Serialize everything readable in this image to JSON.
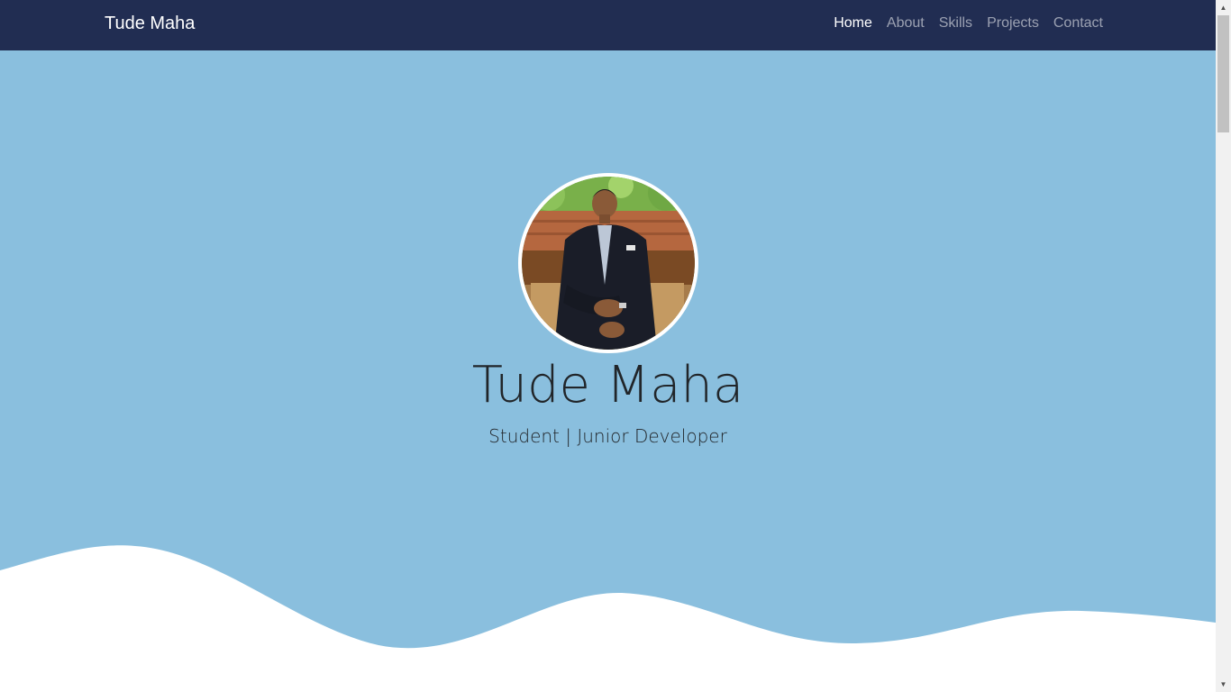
{
  "navbar": {
    "brand": "Tude Maha",
    "links": [
      {
        "label": "Home",
        "active": true
      },
      {
        "label": "About",
        "active": false
      },
      {
        "label": "Skills",
        "active": false
      },
      {
        "label": "Projects",
        "active": false
      },
      {
        "label": "Contact",
        "active": false
      }
    ]
  },
  "hero": {
    "name": "Tude Maha",
    "tagline": "Student | Junior Developer"
  },
  "colors": {
    "navbar_bg": "#212d52",
    "hero_bg": "#8abfde",
    "wave": "#ffffff",
    "text_dark": "#212529"
  },
  "icons": {
    "avatar": "profile-photo",
    "scroll_up": "chevron-up-icon",
    "scroll_down": "chevron-down-icon"
  }
}
